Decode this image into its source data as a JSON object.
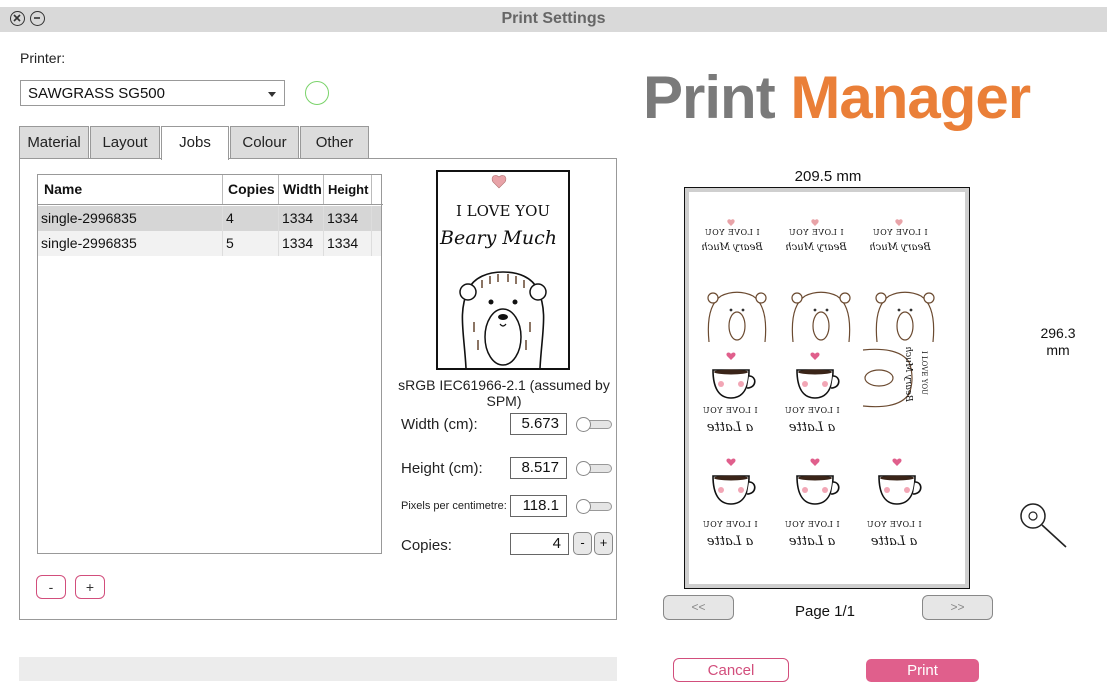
{
  "window": {
    "title": "Print Settings"
  },
  "printer": {
    "label": "Printer:",
    "selected": "SAWGRASS SG500"
  },
  "tabs": [
    {
      "label": "Material"
    },
    {
      "label": "Layout"
    },
    {
      "label": "Jobs",
      "active": true
    },
    {
      "label": "Colour"
    },
    {
      "label": "Other"
    }
  ],
  "jobs_table": {
    "headers": [
      "Name",
      "Copies",
      "Width",
      "Height"
    ],
    "rows": [
      {
        "name": "single-2996835",
        "copies": "4",
        "width": "1334",
        "height": "1334",
        "selected": true
      },
      {
        "name": "single-2996835",
        "copies": "5",
        "width": "1334",
        "height": "1334",
        "selected": false
      }
    ]
  },
  "job_buttons": {
    "remove": "-",
    "add": "+"
  },
  "preview": {
    "line1": "I LOVE YOU",
    "line2": "Beary Much",
    "color_profile": "sRGB IEC61966-2.1 (assumed by SPM)"
  },
  "fields": {
    "width": {
      "label": "Width (cm):",
      "value": "5.673"
    },
    "height": {
      "label": "Height (cm):",
      "value": "8.517"
    },
    "ppc": {
      "label": "Pixels per centimetre:",
      "value": "118.1"
    },
    "copies": {
      "label": "Copies:",
      "value": "4",
      "minus": "-",
      "plus": "+"
    }
  },
  "brand": {
    "part1": "Print ",
    "part2": "Manager",
    "color1": "#7a7a7a",
    "color2": "#ea7f38"
  },
  "sheet": {
    "width_label": "209.5 mm",
    "height_label_top": "296.3",
    "height_label_bottom": "mm",
    "mirrored_text": {
      "love": "I LOVE YOU",
      "beary": "Beary Much",
      "latte": "a Latte"
    }
  },
  "pagination": {
    "prev": "<<",
    "next": ">>",
    "label": "Page 1/1"
  },
  "actions": {
    "cancel": "Cancel",
    "print": "Print"
  },
  "icons": {
    "close": "close-icon",
    "minimize": "minimize-icon",
    "zoom": "magnifier-icon",
    "dropdown": "chevron-down-icon"
  },
  "colors": {
    "accent": "#e05f8c",
    "status_ok": "#7ad36a"
  }
}
